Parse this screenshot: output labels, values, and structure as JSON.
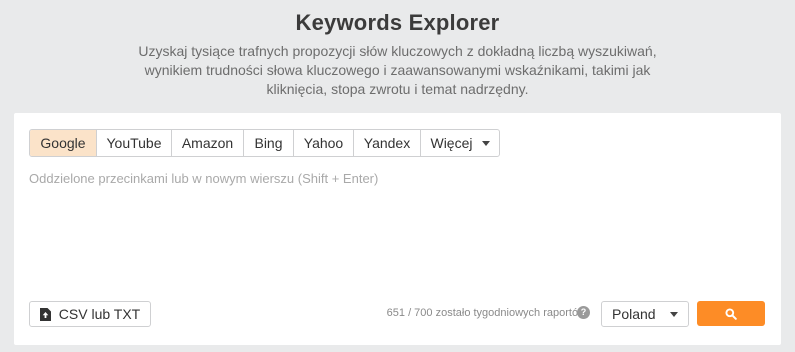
{
  "header": {
    "title": "Keywords Explorer",
    "subtitle_lines": [
      "Uzyskaj tysiące trafnych propozycji słów kluczowych z dokładną liczbą wyszukiwań,",
      "wynikiem trudności słowa kluczowego i zaawansowanymi wskaźnikami, takimi jak",
      "kliknięcia, stopa zwrotu i temat nadrzędny."
    ]
  },
  "engine_tabs": [
    {
      "label": "Google",
      "active": true
    },
    {
      "label": "YouTube",
      "active": false
    },
    {
      "label": "Amazon",
      "active": false
    },
    {
      "label": "Bing",
      "active": false
    },
    {
      "label": "Yahoo",
      "active": false
    },
    {
      "label": "Yandex",
      "active": false
    },
    {
      "label": "Więcej",
      "active": false,
      "icon": "caret-down-icon"
    }
  ],
  "input": {
    "placeholder": "Oddzielone przecinkami lub w nowym wierszu (Shift + Enter)",
    "value": ""
  },
  "upload": {
    "label": "CSV lub TXT",
    "icon": "upload-icon"
  },
  "reports": {
    "text": "651 / 700 zostało tygodniowych raportów",
    "help_icon": "?"
  },
  "country_select": {
    "value": "Poland"
  },
  "search_button": {
    "icon": "search-icon",
    "color": "#fd8c26"
  },
  "colors": {
    "background": "#e9eaeb",
    "active_tab": "#fbe3c9",
    "accent": "#fd8c26"
  }
}
